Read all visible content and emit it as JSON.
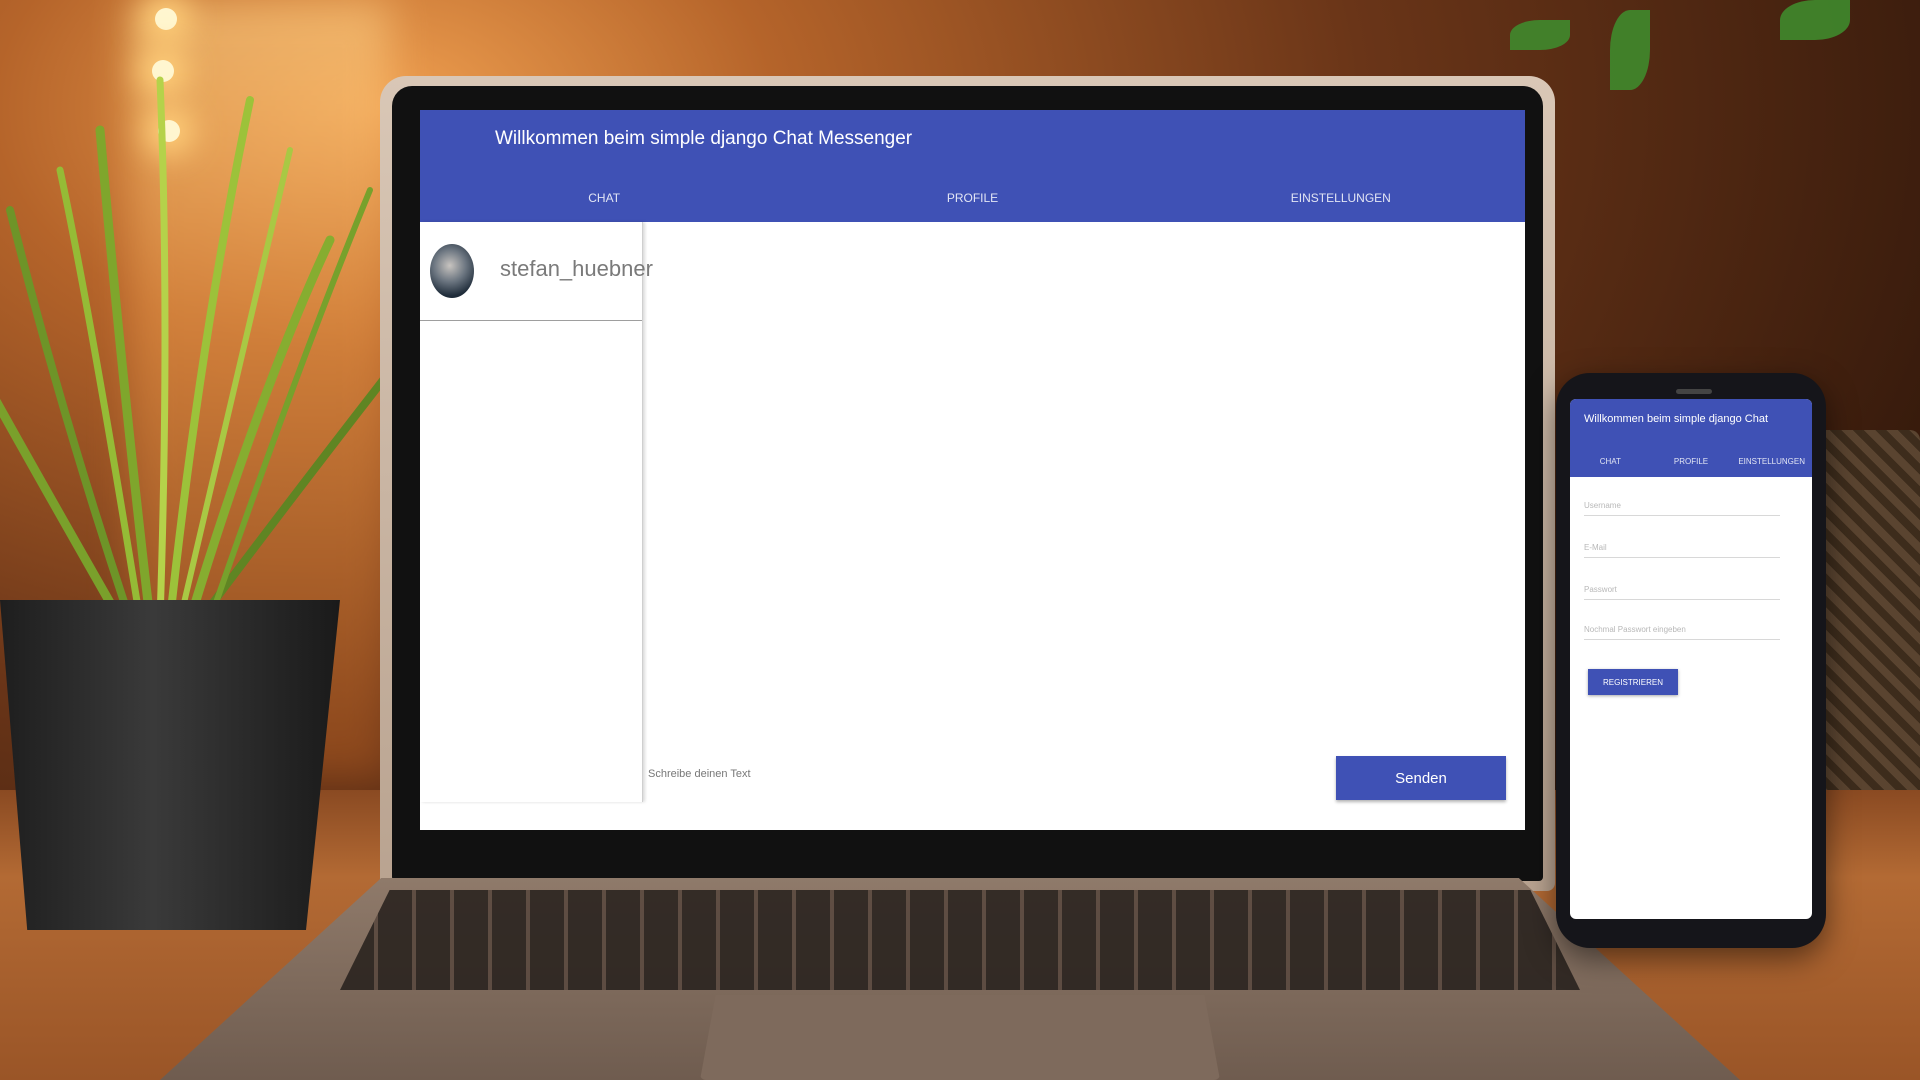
{
  "laptop_app": {
    "title": "Willkommen beim simple django Chat Messenger",
    "tabs": [
      "CHAT",
      "PROFILE",
      "EINSTELLUNGEN"
    ],
    "contacts": [
      {
        "name": "stefan_huebner"
      }
    ],
    "compose_placeholder": "Schreibe deinen Text",
    "send_label": "Senden"
  },
  "phone_app": {
    "title": "Willkommen beim simple django Chat",
    "tabs": [
      "CHAT",
      "PROFILE",
      "EINSTELLUNGEN"
    ],
    "fields": {
      "username": "Username",
      "email": "E-Mail",
      "password": "Passwort",
      "password_repeat": "Nochmal Passwort eingeben"
    },
    "register_label": "REGISTRIEREN"
  },
  "colors": {
    "primary": "#3f51b5",
    "background": "#ffffff"
  }
}
